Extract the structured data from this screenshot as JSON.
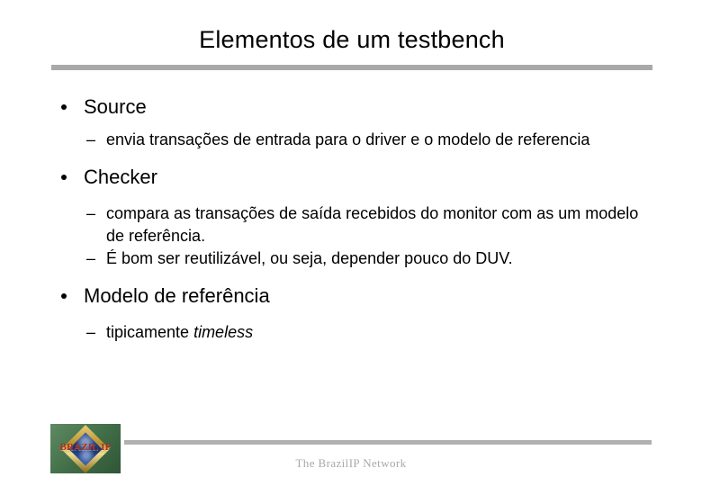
{
  "slide": {
    "title": "Elementos de um testbench",
    "bullets": [
      {
        "label": "Source",
        "sub": [
          "envia transações de entrada para o driver e o modelo de referencia"
        ]
      },
      {
        "label": "Checker",
        "sub": [
          " compara as transações de saída recebidos do monitor com as um modelo de referência.",
          "É bom ser reutilizável, ou seja, depender pouco do DUV."
        ]
      },
      {
        "label": "Modelo de referência",
        "sub_rich": [
          {
            "plain": "tipicamente ",
            "italic": "timeless"
          }
        ]
      }
    ],
    "dash_marker": "–",
    "footer": {
      "text": "The BrazilIP Network"
    },
    "logo": {
      "wordmark": "BRAZIL IP"
    },
    "colors": {
      "title_rule": "#a9a9a9",
      "footer_rule": "#b0b0b0",
      "footer_text": "#a8a8a8",
      "body_text": "#000000",
      "logo_green": "#4c7a52",
      "logo_gold": "#b8902c",
      "logo_blue": "#1b3f86",
      "logo_wordmark_red": "#b02a19"
    }
  }
}
